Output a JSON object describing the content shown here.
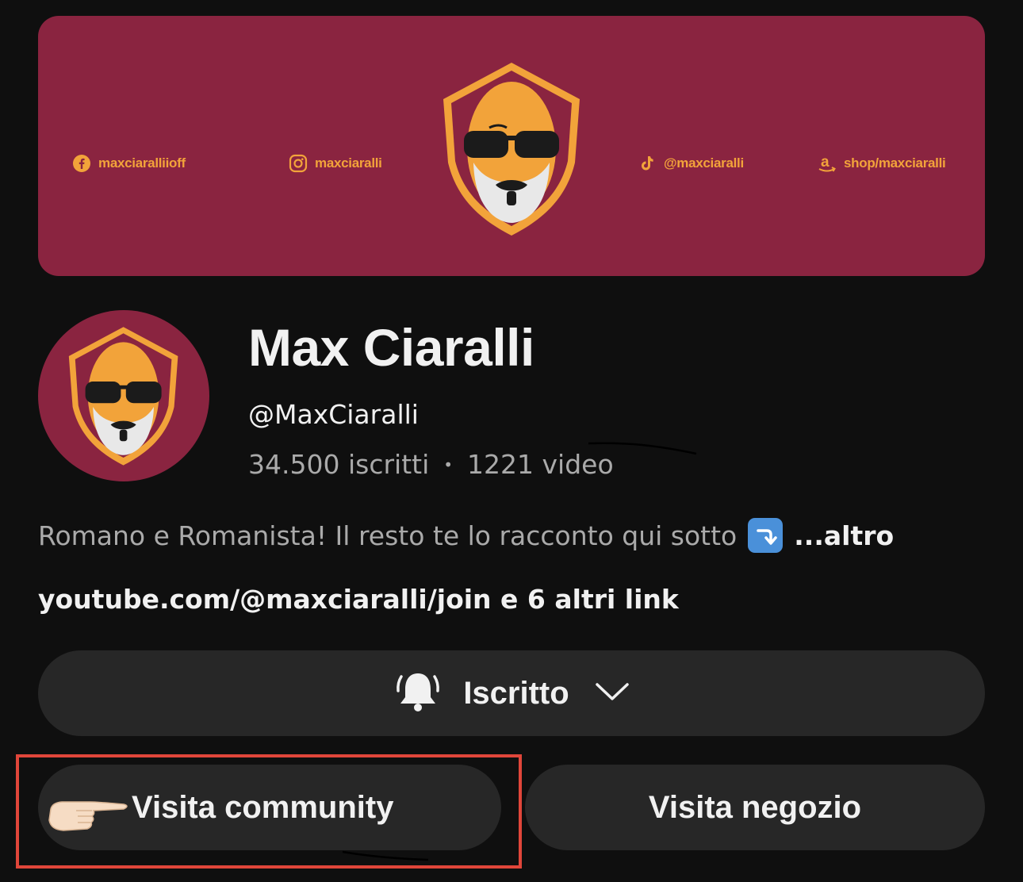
{
  "banner": {
    "socials": [
      {
        "icon": "facebook-icon",
        "text": "maxciaralliioff"
      },
      {
        "icon": "instagram-icon",
        "text": "maxciaralli"
      },
      {
        "icon": "tiktok-icon",
        "text": "@maxciaralli"
      },
      {
        "icon": "amazon-icon",
        "text": "shop/maxciaralli"
      }
    ],
    "background_color": "#8a2440",
    "accent_color": "#f2a33a"
  },
  "channel": {
    "name": "Max Ciaralli",
    "handle": "@MaxCiaralli",
    "subscribers": "34.500 iscritti",
    "separator": "•",
    "videos": "1221 video"
  },
  "description": {
    "text": "Romano e Romanista! Il resto te lo racconto qui sotto",
    "emoji": "arrow-right-curving-down-emoji",
    "more_label": "...altro"
  },
  "links_label": "youtube.com/@maxciaralli/join e 6 altri link",
  "subscribe": {
    "icon": "bell-icon",
    "label": "Iscritto",
    "chevron": "chevron-down-icon"
  },
  "actions": {
    "community_label": "Visita community",
    "community_pointer": "pointing-hand-emoji",
    "shop_label": "Visita negozio",
    "highlight_color": "#e0463a"
  }
}
